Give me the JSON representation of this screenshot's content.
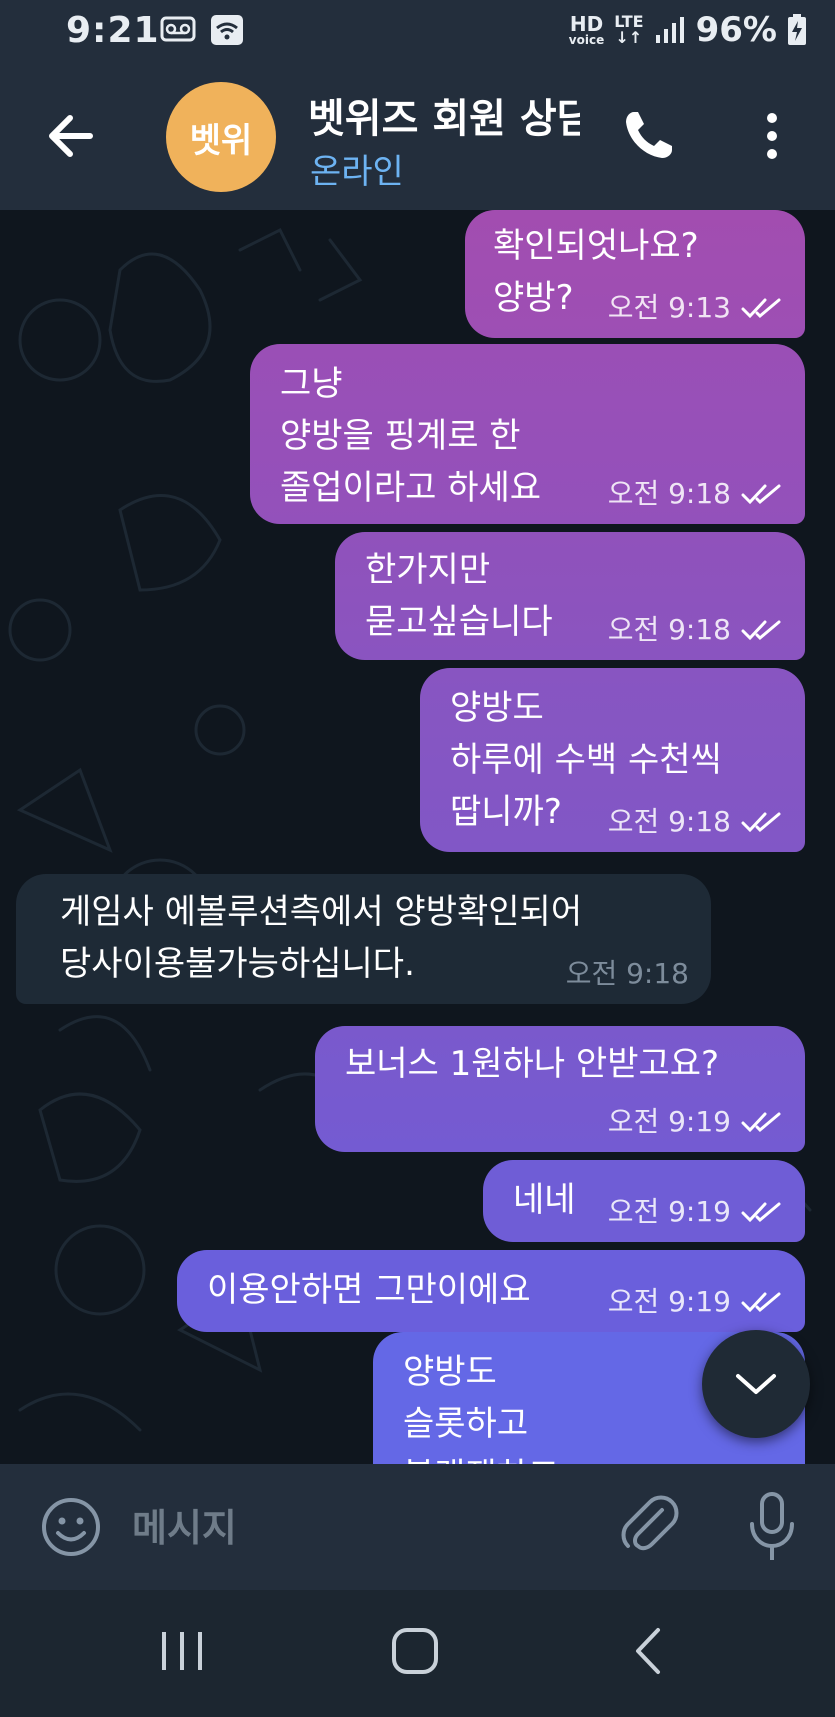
{
  "status_bar": {
    "time": "9:21",
    "hd_label": "HD",
    "voice_label": "voice",
    "lte_label": "LTE",
    "battery": "96%"
  },
  "header": {
    "avatar_text": "벳위",
    "title": "벳위즈 회원 상담",
    "status": "온라인"
  },
  "messages": [
    {
      "dir": "out",
      "text": "확인되엇나요?\n양방?",
      "time": "오전 9:13",
      "read": true
    },
    {
      "dir": "out",
      "text": "그냥\n양방을 핑계로 한\n졸업이라고 하세요",
      "time": "오전 9:18",
      "read": true
    },
    {
      "dir": "out",
      "text": "한가지만\n묻고싶습니다",
      "time": "오전 9:18",
      "read": true
    },
    {
      "dir": "out",
      "text": "양방도\n하루에 수백 수천씩\n땁니까?",
      "time": "오전 9:18",
      "read": true
    },
    {
      "dir": "in",
      "text": "게임사 에볼루션측에서 양방확인되어\n당사이용불가능하십니다.",
      "time": "오전 9:18"
    },
    {
      "dir": "out",
      "text": "보너스 1원하나 안받고요?",
      "time": "오전 9:19",
      "read": true
    },
    {
      "dir": "out",
      "text": "네네",
      "time": "오전 9:19",
      "read": true
    },
    {
      "dir": "out",
      "text": "이용안하면 그만이에요",
      "time": "오전 9:19",
      "read": true
    },
    {
      "dir": "out",
      "text": "양방도\n슬롯하고\n블랙잭하고",
      "time": "",
      "read": false
    }
  ],
  "composer": {
    "placeholder": "메시지"
  },
  "colors": {
    "bubble_top": "#a14fb0",
    "bubble_bottom": "#6467ef",
    "incoming_bubble": "#1e2a36",
    "header_bg": "#232e3c",
    "online": "#6db3f2",
    "avatar": "#f0b25b"
  }
}
